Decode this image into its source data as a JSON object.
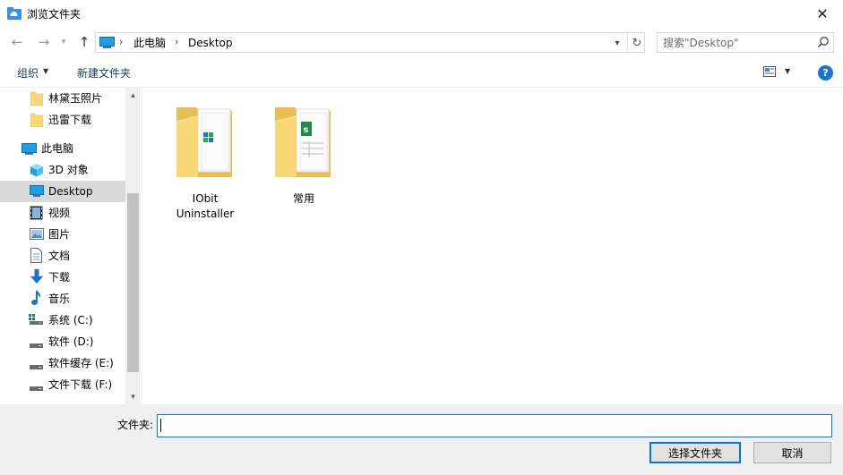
{
  "window": {
    "title": "浏览文件夹",
    "close_glyph": "✕",
    "icon": "folder-cloud-icon"
  },
  "nav": {
    "back_glyph": "←",
    "forward_glyph": "→",
    "recent_glyph": "⌄",
    "up_glyph": "↑"
  },
  "address": {
    "crumbs": [
      "此电脑",
      "Desktop"
    ],
    "separator": "›",
    "dropdown_glyph": "⌄",
    "refresh_glyph": "↻"
  },
  "search": {
    "placeholder": "搜索\"Desktop\""
  },
  "toolbar": {
    "organize_label": "组织",
    "new_folder_label": "新建文件夹",
    "caret": "▼",
    "help_label": "?"
  },
  "sidebar": {
    "items": [
      {
        "label": "林黛玉照片",
        "icon": "folder-icon",
        "level": 2
      },
      {
        "label": "迅雷下载",
        "icon": "folder-icon",
        "level": 2
      },
      {
        "label": "此电脑",
        "icon": "computer-icon",
        "level": 1
      },
      {
        "label": "3D 对象",
        "icon": "3d-objects-icon",
        "level": 2
      },
      {
        "label": "Desktop",
        "icon": "desktop-icon",
        "level": 2,
        "selected": true
      },
      {
        "label": "视频",
        "icon": "video-icon",
        "level": 2
      },
      {
        "label": "图片",
        "icon": "pictures-icon",
        "level": 2
      },
      {
        "label": "文档",
        "icon": "documents-icon",
        "level": 2
      },
      {
        "label": "下载",
        "icon": "downloads-icon",
        "level": 2
      },
      {
        "label": "音乐",
        "icon": "music-icon",
        "level": 2
      },
      {
        "label": "系统 (C:)",
        "icon": "system-drive-icon",
        "level": 2
      },
      {
        "label": "软件 (D:)",
        "icon": "drive-icon",
        "level": 2
      },
      {
        "label": "软件缓存 (E:)",
        "icon": "drive-icon",
        "level": 2
      },
      {
        "label": "文件下载 (F:)",
        "icon": "drive-icon",
        "level": 2
      }
    ],
    "scroll_up_glyph": "⌃",
    "scroll_down_glyph": "⌄"
  },
  "content": {
    "folders": [
      {
        "name": "IObit Uninstaller",
        "icon": "folder-iobit-icon"
      },
      {
        "name": "常用",
        "icon": "folder-excel-icon"
      }
    ]
  },
  "footer": {
    "folder_label": "文件夹:",
    "folder_value": "",
    "select_button": "选择文件夹",
    "cancel_button": "取消"
  },
  "colors": {
    "accent": "#0078d7",
    "selected_bg": "#cce8ff",
    "folder_yellow": "#f8d775",
    "help_blue": "#1a73d1"
  }
}
